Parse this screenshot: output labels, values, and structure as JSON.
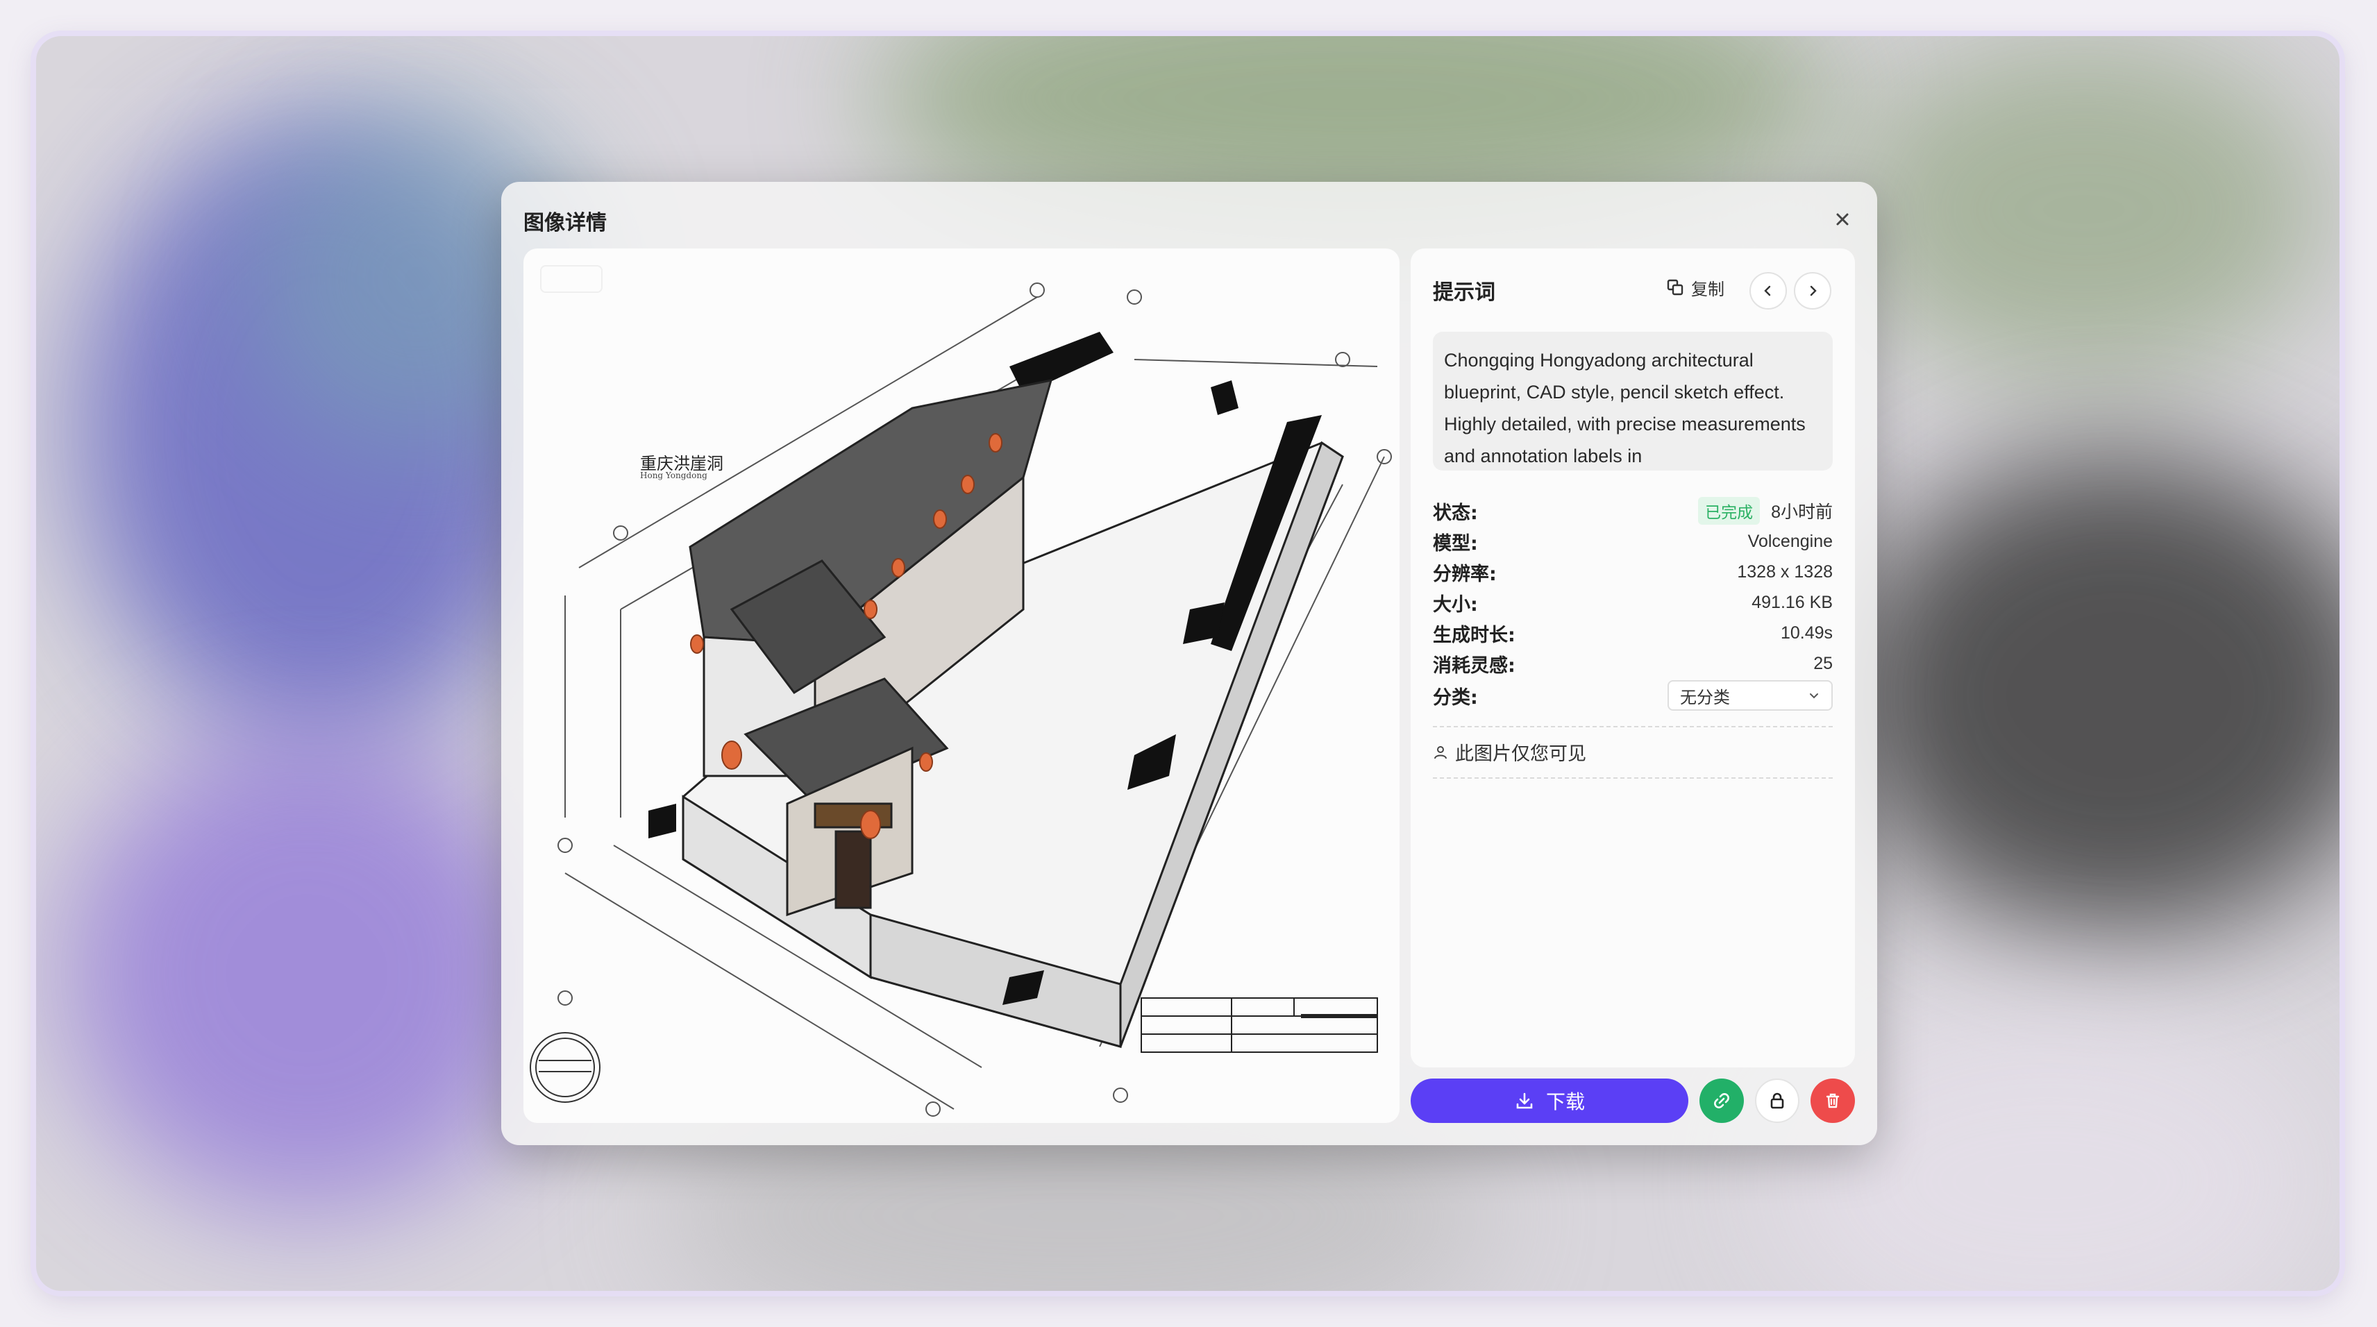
{
  "modal": {
    "title": "图像详情"
  },
  "prompt_panel": {
    "title": "提示词",
    "copy_label": "复制",
    "prompt_text": "Chongqing Hongyadong architectural blueprint, CAD style, pencil sketch effect. Highly detailed, with precise measurements and annotation labels in"
  },
  "info": {
    "status": {
      "label": "状态:",
      "badge": "已完成",
      "time": "8小时前"
    },
    "model": {
      "label": "模型:",
      "value": "Volcengine"
    },
    "resolution": {
      "label": "分辨率:",
      "value": "1328 x 1328"
    },
    "size": {
      "label": "大小:",
      "value": "491.16 KB"
    },
    "duration": {
      "label": "生成时长:",
      "value": "10.49s"
    },
    "credits": {
      "label": "消耗灵感:",
      "value": "25"
    },
    "category": {
      "label": "分类:",
      "value": "无分类"
    }
  },
  "visibility_text": "此图片仅您可见",
  "image_labels": {
    "title_cn": "重庆洪崖洞",
    "title_en": "Hong Yongdong"
  },
  "actions": {
    "download_label": "下载"
  },
  "colors": {
    "accent": "#5b3ff5",
    "link_green": "#22b068",
    "delete_red": "#ee4b4b",
    "status_green": "#2bb164"
  }
}
